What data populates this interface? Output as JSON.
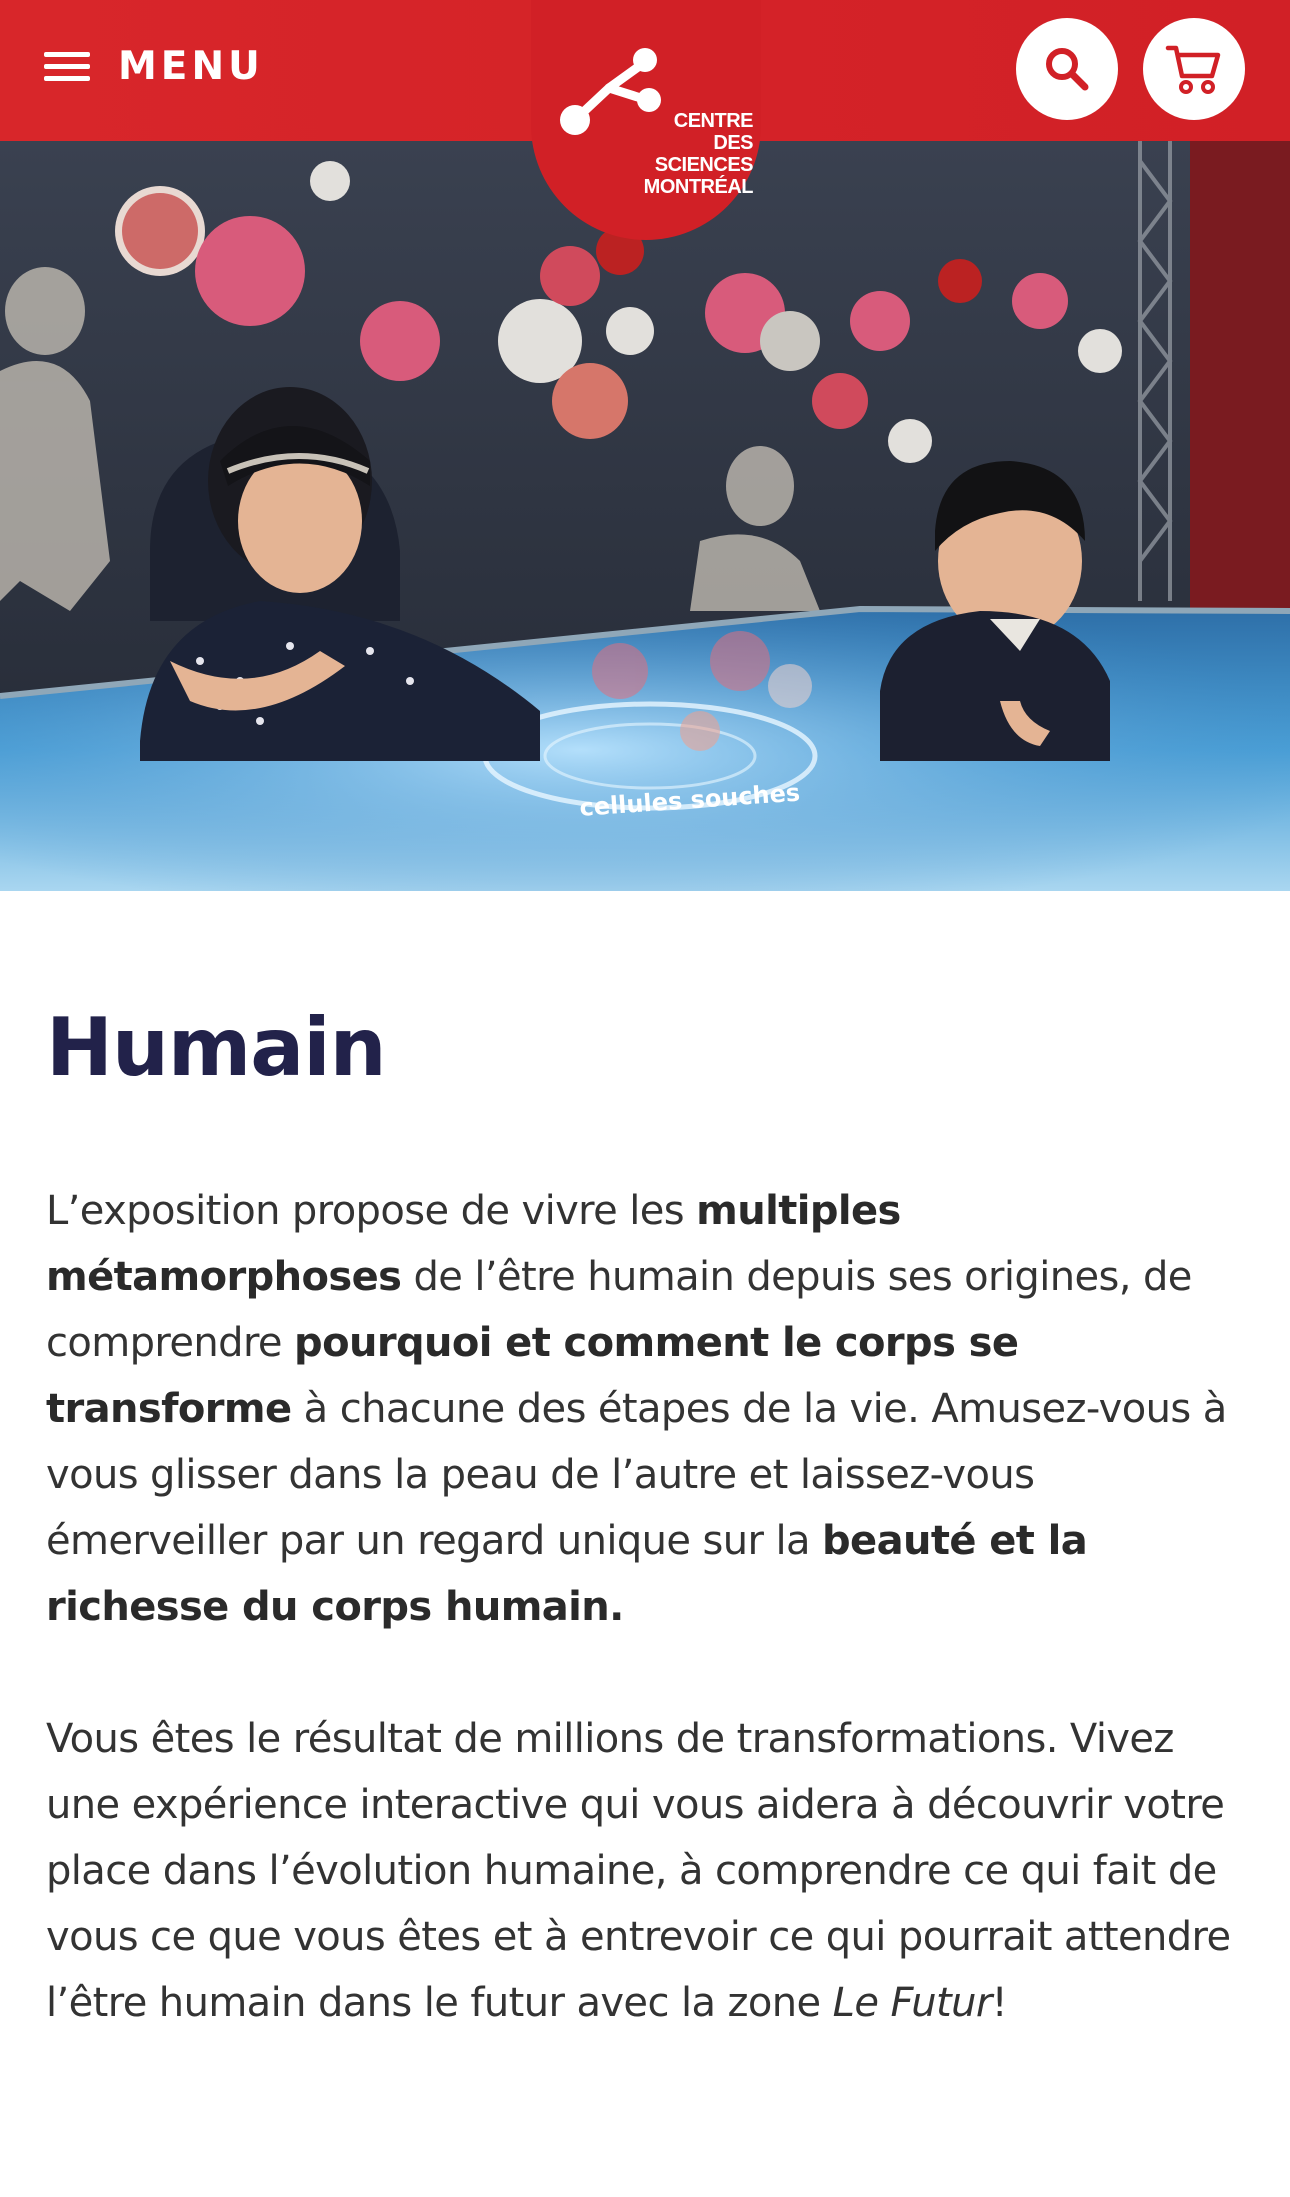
{
  "header": {
    "menu_label": "MENU",
    "logo": {
      "lines": [
        "CENTRE",
        "DES",
        "SCIENCES",
        "MONTRÉAL"
      ]
    },
    "search_icon": "search-icon",
    "cart_icon": "cart-icon",
    "colors": {
      "brand_red": "#d12026"
    }
  },
  "hero": {
    "table_text": "cellules souches"
  },
  "article": {
    "title": "Humain",
    "p1": [
      {
        "t": "L’exposition propose de vivre les "
      },
      {
        "t": "multiples métamorphoses",
        "b": true
      },
      {
        "t": " de l’être humain depuis ses origines, de comprendre "
      },
      {
        "t": "pourquoi et comment le corps se transforme",
        "b": true
      },
      {
        "t": " à chacune des étapes de la vie. Amusez-vous à vous glisser dans la peau de l’autre et laissez-vous émerveiller par un regard unique sur la "
      },
      {
        "t": "beauté et la richesse du corps humain.",
        "b": true
      }
    ],
    "p2": [
      {
        "t": "Vous êtes le résultat de millions de transformations. Vivez une expérience interactive qui vous aidera à découvrir votre place dans l’évolution humaine, à comprendre ce qui fait de vous ce que vous êtes et à entrevoir ce qui pourrait attendre l’être humain dans le futur avec la zone "
      },
      {
        "t": "Le Futur",
        "i": true
      },
      {
        "t": "!"
      }
    ],
    "colors": {
      "title": "#22224a",
      "text": "#333333"
    }
  }
}
